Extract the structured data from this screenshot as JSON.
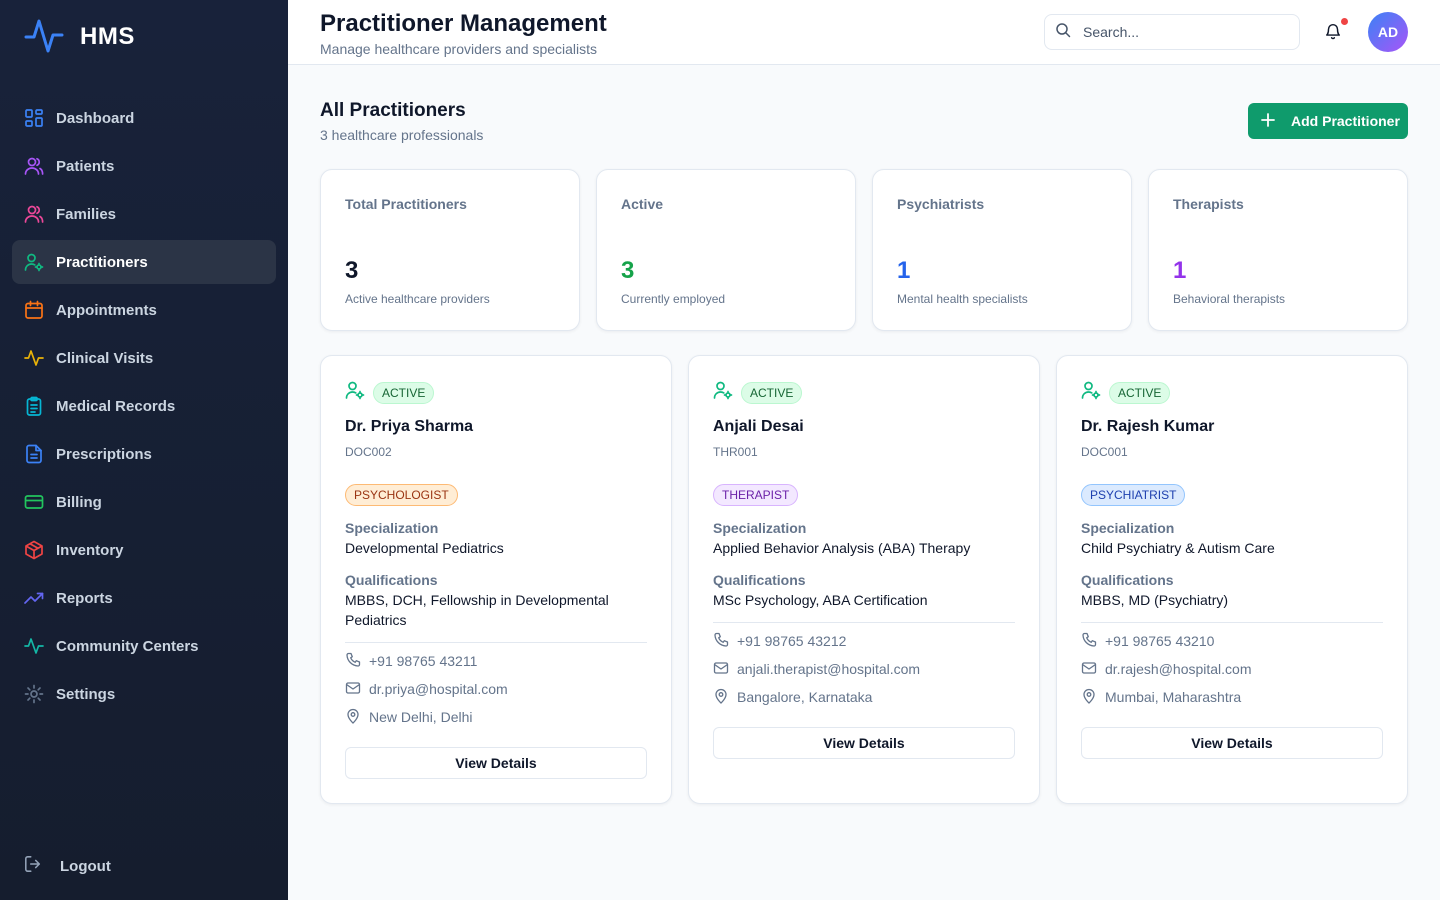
{
  "brand": {
    "name": "HMS"
  },
  "sidebar": {
    "items": [
      {
        "label": "Dashboard",
        "icon": "dashboard-icon",
        "color": "#3b82f6"
      },
      {
        "label": "Patients",
        "icon": "users-icon",
        "color": "#a855f7"
      },
      {
        "label": "Families",
        "icon": "users-icon",
        "color": "#ec4899"
      },
      {
        "label": "Practitioners",
        "icon": "user-cog-icon",
        "color": "#10b981",
        "active": true
      },
      {
        "label": "Appointments",
        "icon": "calendar-icon",
        "color": "#f97316"
      },
      {
        "label": "Clinical Visits",
        "icon": "activity-icon",
        "color": "#eab308"
      },
      {
        "label": "Medical Records",
        "icon": "clipboard-icon",
        "color": "#06b6d4"
      },
      {
        "label": "Prescriptions",
        "icon": "file-text-icon",
        "color": "#3b82f6"
      },
      {
        "label": "Billing",
        "icon": "credit-card-icon",
        "color": "#22c55e"
      },
      {
        "label": "Inventory",
        "icon": "package-icon",
        "color": "#ef4444"
      },
      {
        "label": "Reports",
        "icon": "trending-up-icon",
        "color": "#6366f1"
      },
      {
        "label": "Community Centers",
        "icon": "activity-icon",
        "color": "#14b8a6"
      },
      {
        "label": "Settings",
        "icon": "gear-icon",
        "color": "#64748b"
      }
    ],
    "logout": "Logout"
  },
  "header": {
    "title": "Practitioner Management",
    "subtitle": "Manage healthcare providers and specialists",
    "search_placeholder": "Search...",
    "avatar_initials": "AD"
  },
  "main": {
    "title": "All Practitioners",
    "subtitle": "3 healthcare professionals",
    "add_button": "Add Practitioner",
    "stats": [
      {
        "label": "Total Practitioners",
        "value": "3",
        "desc": "Active healthcare providers",
        "color": "#0f172a"
      },
      {
        "label": "Active",
        "value": "3",
        "desc": "Currently employed",
        "color": "#16a34a"
      },
      {
        "label": "Psychiatrists",
        "value": "1",
        "desc": "Mental health specialists",
        "color": "#2563eb"
      },
      {
        "label": "Therapists",
        "value": "1",
        "desc": "Behavioral therapists",
        "color": "#9333ea"
      }
    ],
    "labels": {
      "specialization": "Specialization",
      "qualifications": "Qualifications",
      "view_details": "View Details"
    },
    "practitioners": [
      {
        "status": "ACTIVE",
        "name": "Dr. Priya Sharma",
        "id": "DOC002",
        "role": "PSYCHOLOGIST",
        "role_bg": "#ffedd5",
        "role_border": "#fdba74",
        "role_color": "#9a3412",
        "specialization": "Developmental Pediatrics",
        "qualifications": "MBBS, DCH, Fellowship in Developmental Pediatrics",
        "phone": "+91 98765 43211",
        "email": "dr.priya@hospital.com",
        "location": "New Delhi, Delhi"
      },
      {
        "status": "ACTIVE",
        "name": "Anjali Desai",
        "id": "THR001",
        "role": "THERAPIST",
        "role_bg": "#f3e8ff",
        "role_border": "#d8b4fe",
        "role_color": "#6b21a8",
        "specialization": "Applied Behavior Analysis (ABA) Therapy",
        "qualifications": "MSc Psychology, ABA Certification",
        "phone": "+91 98765 43212",
        "email": "anjali.therapist@hospital.com",
        "location": "Bangalore, Karnataka"
      },
      {
        "status": "ACTIVE",
        "name": "Dr. Rajesh Kumar",
        "id": "DOC001",
        "role": "PSYCHIATRIST",
        "role_bg": "#dbeafe",
        "role_border": "#93c5fd",
        "role_color": "#1e40af",
        "specialization": "Child Psychiatry & Autism Care",
        "qualifications": "MBBS, MD (Psychiatry)",
        "phone": "+91 98765 43210",
        "email": "dr.rajesh@hospital.com",
        "location": "Mumbai, Maharashtra"
      }
    ]
  }
}
